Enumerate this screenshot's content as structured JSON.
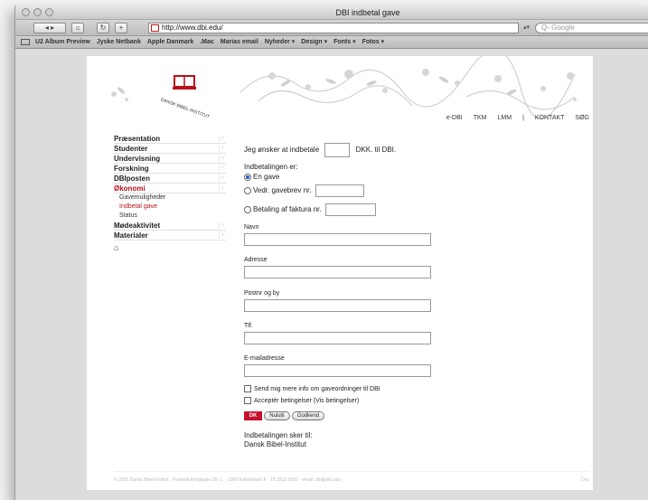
{
  "window": {
    "title": "DBI indbetal gave"
  },
  "toolbar": {
    "back_fwd": "◂ ▸",
    "address": "http://www.dbi.edu/",
    "search_placeholder": "Q- Google"
  },
  "bookmarks": {
    "items": [
      "U2 Album Preview",
      "Jyske Netbank",
      "Apple Danmark",
      ".Mac",
      "Marias email",
      "Nyheder ▾",
      "Design ▾",
      "Fonts ▾",
      "Fotos ▾"
    ]
  },
  "header": {
    "logo_text": "DANSK BIBEL-INSTITUT",
    "nav": [
      "e-DBI",
      "TKM",
      "LMM",
      "|",
      "KONTAKT",
      "SØG"
    ]
  },
  "sidebar": {
    "items": [
      "Præsentation",
      "Studenter",
      "Undervisning",
      "Forskning",
      "DBIposten",
      "Økonomi"
    ],
    "sub_items": [
      "Gavemuligheder",
      "Indbetal gave",
      "Status"
    ],
    "items2": [
      "Mødeaktivitet",
      "Materialer"
    ],
    "home": "⌂"
  },
  "form": {
    "intro_prefix": "Jeg ønsker at indbetale",
    "intro_suffix": "DKK. til DBI.",
    "type_label": "Indbetalingen er:",
    "option1": "En gave",
    "option2": "Vedr. gavebrev nr.",
    "option3": "Betaling af faktura nr.",
    "name_label": "Navn",
    "address_label": "Adresse",
    "postal_label": "Postnr og by",
    "phone_label": "Tlf.",
    "email_label": "E-mailadresse",
    "check1": "Send mig mere info om gaveordninger til DBI",
    "check2": "Acceptér betingelser (Vis betingelser)",
    "badge": "DK",
    "btn1": "Nulstil",
    "btn2": "Godkend",
    "note_line1": "Indbetalingen sker til:",
    "note_line2": "Dansk Bibel-Institut"
  },
  "footer": {
    "text": "© 2005 Dansk Bibel-Institut · Frederiksborggade 1B, 1. · 1360 København K · Tlf 3313 5500 · email: dbi@dbi.edu",
    "right": "Dns"
  }
}
